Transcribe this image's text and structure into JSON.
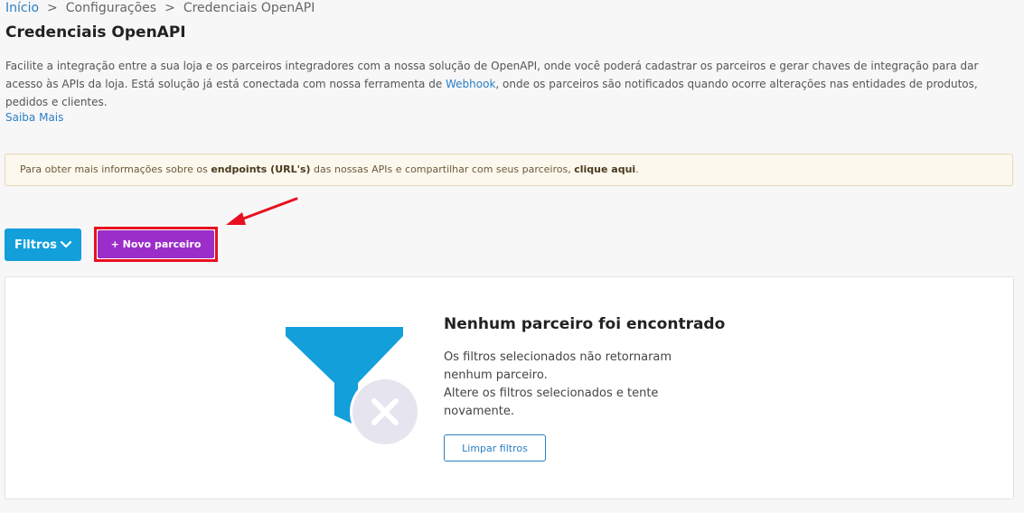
{
  "breadcrumb": {
    "home": "Início",
    "separator": ">",
    "settings": "Configurações",
    "current": "Credenciais OpenAPI"
  },
  "page": {
    "title": "Credenciais OpenAPI",
    "description_before_link": "Facilite a integração entre a sua loja e os parceiros integradores com a nossa solução de OpenAPI, onde você poderá cadastrar os parceiros e gerar chaves de integração para dar acesso às APIs da loja. Está solução já está conectada com nossa ferramenta de ",
    "description_link": "Webhook",
    "description_after_link": ", onde os parceiros são notificados quando ocorre alterações nas entidades de produtos, pedidos e clientes.",
    "learn_more": "Saiba Mais"
  },
  "alert": {
    "text_1": "Para obter mais informações sobre os ",
    "bold_1": "endpoints (URL's)",
    "text_2": " das nossas APIs e compartilhar com seus parceiros, ",
    "bold_2": "clique aqui",
    "text_3": "."
  },
  "toolbar": {
    "filters_label": "Filtros",
    "new_partner_label": "+ Novo parceiro"
  },
  "empty_state": {
    "title": "Nenhum parceiro foi encontrado",
    "line_1": "Os filtros selecionados não retornaram nenhum parceiro.",
    "line_2": "Altere os filtros selecionados e tente novamente.",
    "clear_button": "Limpar filtros",
    "icon": "funnel-x-icon"
  },
  "colors": {
    "link": "#2a7fc4",
    "filters_button": "#129fda",
    "new_partner_button": "#9b2ec9",
    "highlight": "#e8101e",
    "funnel": "#129fda"
  }
}
